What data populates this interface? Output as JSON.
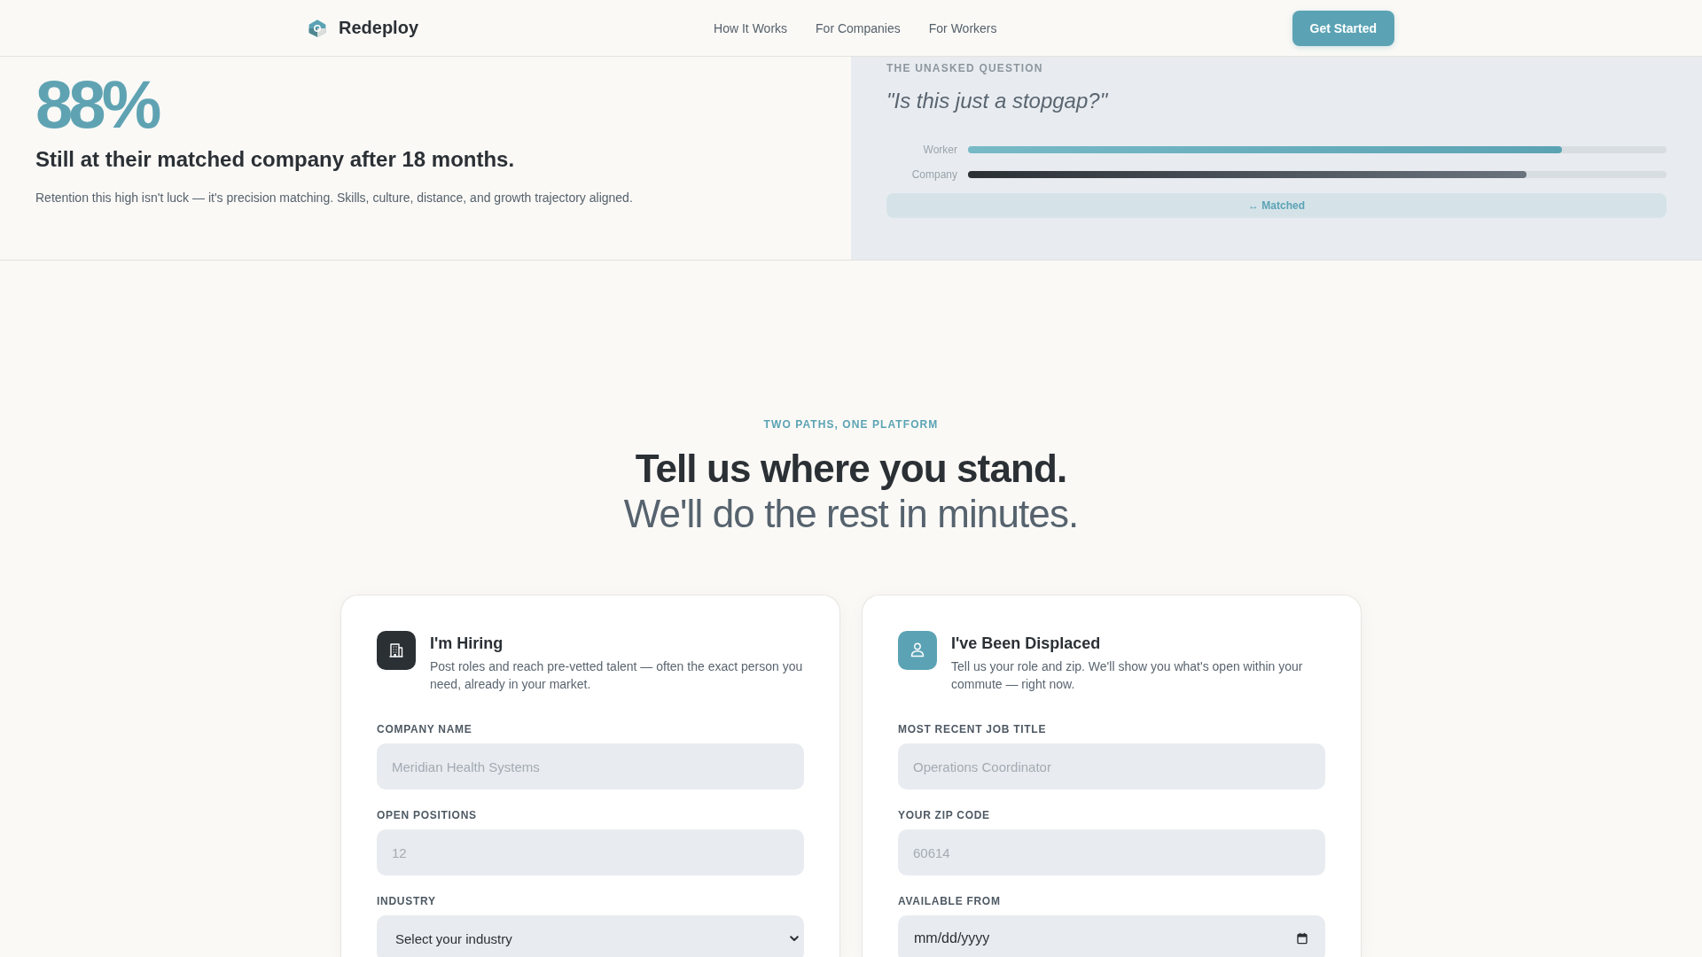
{
  "header": {
    "brand": "Redeploy",
    "nav": [
      "How It Works",
      "For Companies",
      "For Workers"
    ],
    "cta": "Get Started"
  },
  "stat": {
    "value": "88%",
    "headline": "Still at their matched company after 18 months.",
    "body": "Retention this high isn't luck — it's precision matching. Skills, culture, distance, and growth trajectory aligned."
  },
  "question": {
    "eyebrow": "THE UNASKED QUESTION",
    "quote": "\"Is this just a stopgap?\"",
    "bars": [
      {
        "label": "Worker",
        "kind": "accent",
        "level": 0.85
      },
      {
        "label": "Company",
        "kind": "dark",
        "level": 0.8
      }
    ],
    "result": "↔ Matched"
  },
  "paths": {
    "eyebrow": "TWO PATHS, ONE PLATFORM",
    "title": "Tell us where you stand.",
    "subtitle": "We'll do the rest in minutes.",
    "cards": [
      {
        "kind": "employer",
        "title": "I'm Hiring",
        "description": "Post roles and reach pre-vetted talent — often the exact person you need, already in your market.",
        "fields": [
          {
            "kind": "text",
            "label": "COMPANY NAME",
            "placeholder": "Meridian Health Systems"
          },
          {
            "kind": "text",
            "label": "OPEN POSITIONS",
            "placeholder": "12"
          },
          {
            "kind": "select",
            "label": "INDUSTRY",
            "value": "Select your industry"
          }
        ]
      },
      {
        "kind": "worker",
        "title": "I've Been Displaced",
        "description": "Tell us your role and zip. We'll show you what's open within your commute — right now.",
        "fields": [
          {
            "kind": "text",
            "label": "MOST RECENT JOB TITLE",
            "placeholder": "Operations Coordinator"
          },
          {
            "kind": "text",
            "label": "YOUR ZIP CODE",
            "placeholder": "60614"
          },
          {
            "kind": "date",
            "label": "AVAILABLE FROM",
            "placeholder": "mm/dd/yyyy"
          }
        ]
      }
    ]
  }
}
